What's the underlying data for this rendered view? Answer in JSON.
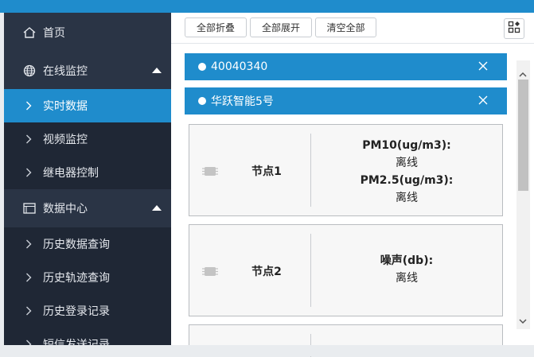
{
  "sidebar": {
    "items": [
      {
        "label": "首页",
        "icon": "home-icon"
      },
      {
        "label": "在线监控",
        "icon": "globe-icon"
      },
      {
        "label": "实时数据",
        "icon": "chevron-right-icon"
      },
      {
        "label": "视频监控",
        "icon": "chevron-right-icon"
      },
      {
        "label": "继电器控制",
        "icon": "chevron-right-icon"
      },
      {
        "label": "数据中心",
        "icon": "calendar-icon"
      },
      {
        "label": "历史数据查询",
        "icon": "chevron-right-icon"
      },
      {
        "label": "历史轨迹查询",
        "icon": "chevron-right-icon"
      },
      {
        "label": "历史登录记录",
        "icon": "chevron-right-icon"
      },
      {
        "label": "短信发送记录",
        "icon": "chevron-right-icon"
      }
    ]
  },
  "toolbar": {
    "collapse_all": "全部折叠",
    "expand_all": "全部展开",
    "clear_all": "清空全部"
  },
  "devices": [
    {
      "name": "40040340"
    },
    {
      "name": "华跃智能5号"
    }
  ],
  "nodes": [
    {
      "name": "节点1",
      "values": [
        {
          "label": "PM10(ug/m3):",
          "value": "离线"
        },
        {
          "label": "PM2.5(ug/m3):",
          "value": "离线"
        }
      ]
    },
    {
      "name": "节点2",
      "values": [
        {
          "label": "噪声(db):",
          "value": "离线"
        }
      ]
    }
  ],
  "colors": {
    "accent": "#1f8ccc",
    "sidebar_bg": "#2a3445",
    "sidebar_sub_bg": "#1f2735"
  }
}
